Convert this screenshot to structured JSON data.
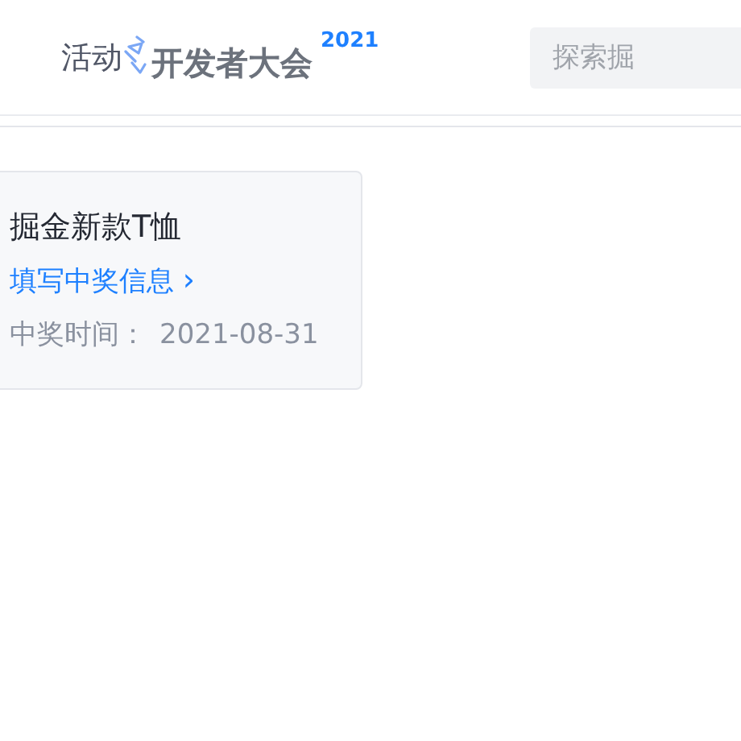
{
  "nav": {
    "items": [
      {
        "label": "活动"
      }
    ]
  },
  "logo": {
    "text": "开发者大会",
    "year": "2021"
  },
  "search": {
    "placeholder": "探索掘"
  },
  "prize_card": {
    "title": "掘金新款T恤",
    "link": "填写中奖信息",
    "link_arrow": "›",
    "date_label": "中奖时间：",
    "date": "2021-08-31"
  }
}
